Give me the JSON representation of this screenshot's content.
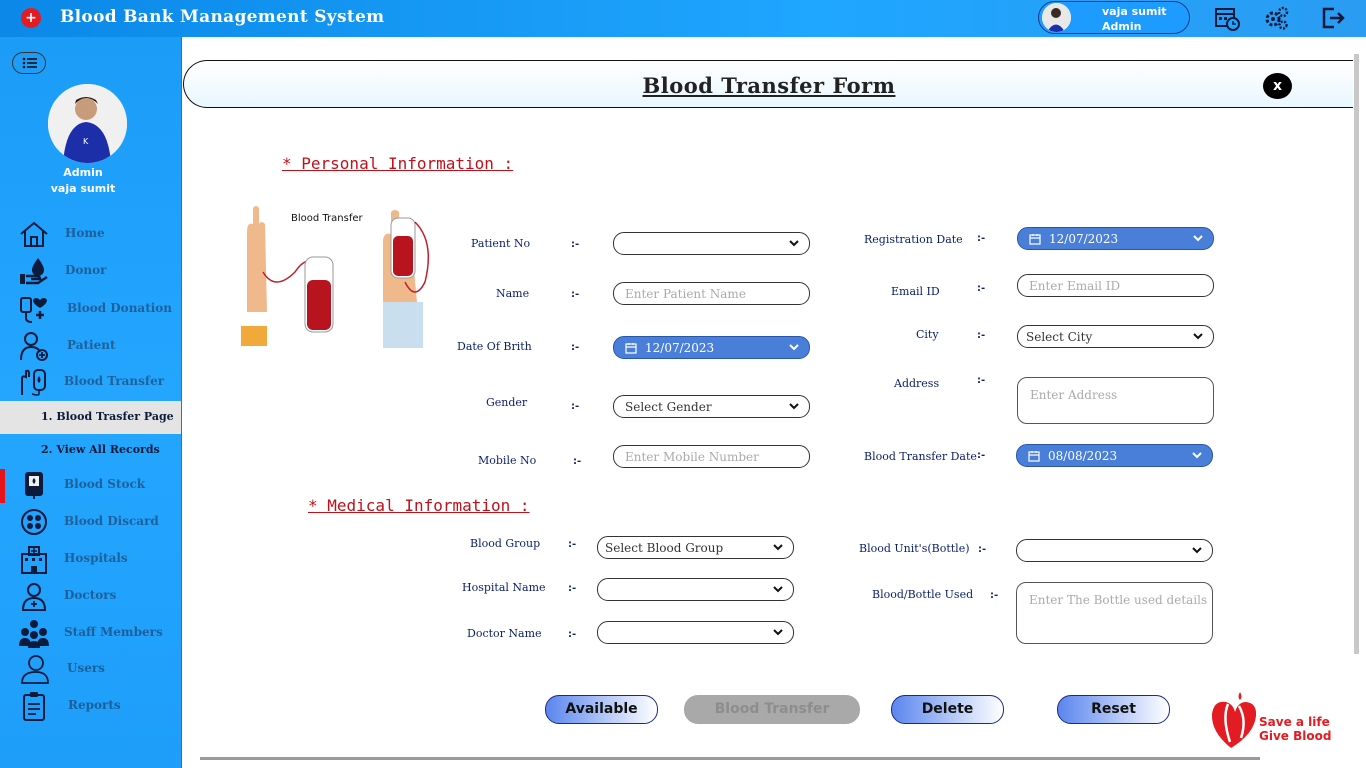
{
  "app": {
    "title": "Blood Bank Management System",
    "user_name": "vaja sumit",
    "user_role": "Admin"
  },
  "sidebar": {
    "role": "Admin",
    "name": "vaja sumit",
    "items": [
      {
        "label": "Home",
        "icon": "home-icon"
      },
      {
        "label": "Donor",
        "icon": "donor-icon"
      },
      {
        "label": "Blood Donation",
        "icon": "blood-donation-icon"
      },
      {
        "label": "Patient",
        "icon": "patient-icon"
      },
      {
        "label": "Blood Transfer",
        "icon": "blood-transfer-icon"
      },
      {
        "label": "Blood Stock",
        "icon": "blood-stock-icon"
      },
      {
        "label": "Blood Discard",
        "icon": "blood-discard-icon"
      },
      {
        "label": "Hospitals",
        "icon": "hospital-icon"
      },
      {
        "label": "Doctors",
        "icon": "doctor-icon"
      },
      {
        "label": "Staff Members",
        "icon": "staff-icon"
      },
      {
        "label": "Users",
        "icon": "users-icon"
      },
      {
        "label": "Reports",
        "icon": "reports-icon"
      }
    ],
    "sub_items": [
      {
        "label": "1.  Blood Trasfer Page"
      },
      {
        "label": "2.  View All Records"
      }
    ]
  },
  "form": {
    "title": "Blood Transfer Form",
    "close_label": "x",
    "personal_section": "*  Personal Information  :",
    "medical_section": "*  Medical Information  :",
    "illustration_caption": "Blood Transfer",
    "colon": ":-",
    "fields": {
      "patient_no": {
        "label": "Patient No",
        "value": ""
      },
      "name": {
        "label": "Name",
        "placeholder": "Enter Patient Name"
      },
      "dob": {
        "label": "Date Of Brith",
        "value": "12/07/2023"
      },
      "gender": {
        "label": "Gender",
        "value": "Select Gender"
      },
      "mobile": {
        "label": "Mobile No",
        "placeholder": "Enter Mobile Number"
      },
      "reg_date": {
        "label": "Registration Date",
        "value": "12/07/2023"
      },
      "email": {
        "label": "Email ID",
        "placeholder": "Enter Email ID"
      },
      "city": {
        "label": "City",
        "value": "Select City"
      },
      "address": {
        "label": "Address",
        "placeholder": "Enter Address"
      },
      "transfer_date": {
        "label": "Blood Transfer Date",
        "value": "08/08/2023"
      },
      "blood_group": {
        "label": "Blood Group",
        "value": "Select Blood Group"
      },
      "hospital": {
        "label": "Hospital Name",
        "value": ""
      },
      "doctor": {
        "label": "Doctor Name",
        "value": ""
      },
      "units": {
        "label": "Blood Unit's(Bottle)",
        "value": ""
      },
      "bottle_used": {
        "label": "Blood/Bottle Used",
        "placeholder": "Enter The Bottle used details"
      }
    },
    "buttons": {
      "available": "Available",
      "transfer": "Blood Transfer",
      "delete": "Delete",
      "reset": "Reset"
    },
    "badge": {
      "line1": "Save a life",
      "line2": "Give Blood"
    }
  },
  "colors": {
    "accent": "#1e9bff",
    "date_field": "#4a7fd9",
    "section": "#c0101a",
    "brand_red": "#e31b23"
  }
}
